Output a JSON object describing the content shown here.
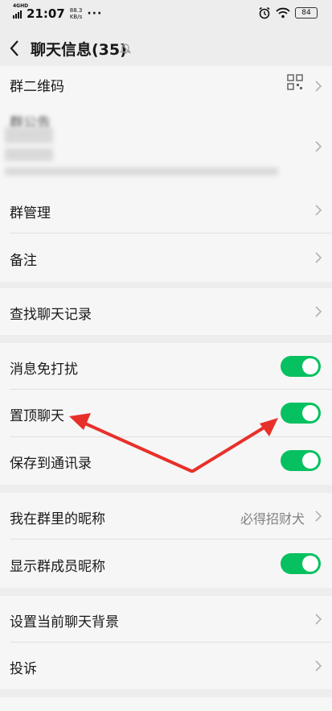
{
  "status_bar": {
    "network": "4GHD",
    "time": "21:07",
    "speed_value": "88.3",
    "speed_unit": "KB/s",
    "more": "···",
    "battery": "84"
  },
  "nav": {
    "title": "聊天信息(35)"
  },
  "rows": {
    "qrcode": "群二维码",
    "notice": "群公告",
    "manage": "群管理",
    "remark": "备注",
    "search_history": "查找聊天记录",
    "mute": "消息免打扰",
    "pin": "置顶聊天",
    "save_contacts": "保存到通讯录",
    "my_nickname": "我在群里的昵称",
    "my_nickname_value": "必得招财犬",
    "show_nicknames": "显示群成员昵称",
    "set_background": "设置当前聊天背景",
    "report": "投诉"
  },
  "toggles": {
    "mute": true,
    "pin": true,
    "save_contacts": true,
    "show_nicknames": true
  },
  "colors": {
    "page_bg": "#ededed",
    "cell_bg": "#f6f6f6",
    "toggle_on": "#07c160",
    "annotation_arrow": "#e8302a"
  },
  "icons": {
    "back": "chevron-left-icon",
    "mute": "bell-off-icon",
    "qr": "qr-code-icon",
    "arrow": "chevron-right-icon"
  }
}
